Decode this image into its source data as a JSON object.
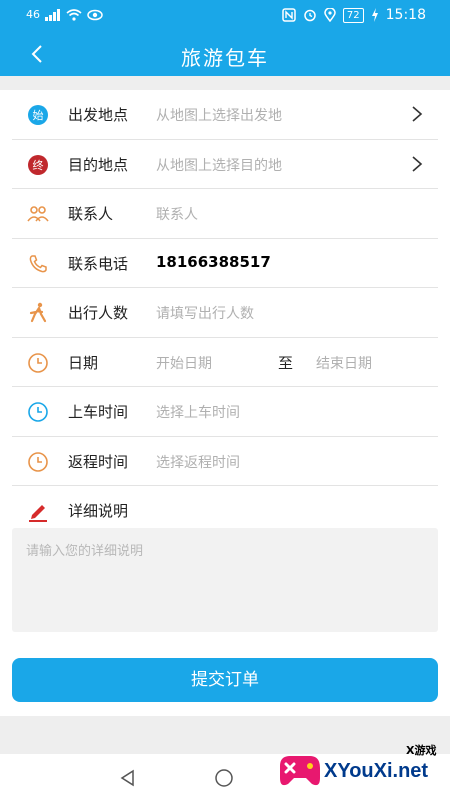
{
  "status_bar": {
    "left_indicators": "46",
    "battery": "72",
    "time": "15:18"
  },
  "header": {
    "title": "旅游包车"
  },
  "form": {
    "departure": {
      "label": "出发地点",
      "placeholder": "从地图上选择出发地",
      "icon_text": "始"
    },
    "destination": {
      "label": "目的地点",
      "placeholder": "从地图上选择目的地",
      "icon_text": "终"
    },
    "contact": {
      "label": "联系人",
      "placeholder": "联系人"
    },
    "phone": {
      "label": "联系电话",
      "value": "18166388517"
    },
    "passengers": {
      "label": "出行人数",
      "placeholder": "请填写出行人数"
    },
    "date": {
      "label": "日期",
      "start_placeholder": "开始日期",
      "separator": "至",
      "end_placeholder": "结束日期"
    },
    "pickup_time": {
      "label": "上车时间",
      "placeholder": "选择上车时间"
    },
    "return_time": {
      "label": "返程时间",
      "placeholder": "选择返程时间"
    },
    "details": {
      "label": "详细说明",
      "placeholder": "请输入您的详细说明"
    }
  },
  "submit_label": "提交订单",
  "watermark": {
    "top_text": "X游戏",
    "site": "XYouXi.net"
  },
  "colors": {
    "primary": "#1aa7e8",
    "start_icon": "#1aa7e8",
    "end_icon": "#c0282d",
    "accent_orange": "#e8944a",
    "accent_red": "#d62b2b"
  }
}
